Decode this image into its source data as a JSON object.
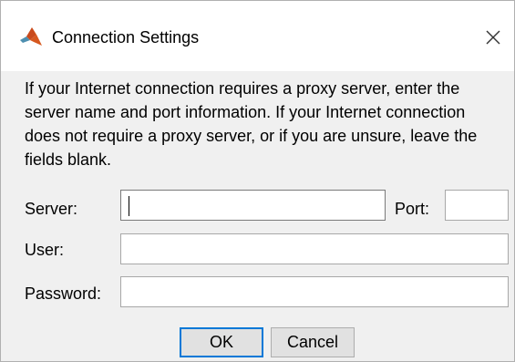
{
  "window": {
    "title": "Connection Settings",
    "app_icon": "matlab-membrane-icon",
    "close_icon": "close-icon"
  },
  "description": "If your Internet connection requires a proxy server, enter the server name and port information. If your Internet connection does not require a proxy server, or if you are unsure, leave the fields blank.",
  "form": {
    "server_label": "Server:",
    "server_value": "",
    "port_label": "Port:",
    "port_value": "",
    "user_label": "User:",
    "user_value": "",
    "password_label": "Password:",
    "password_value": ""
  },
  "buttons": {
    "ok_label": "OK",
    "cancel_label": "Cancel"
  },
  "colors": {
    "dialog_background": "#f0f0f0",
    "titlebar_background": "#ffffff",
    "default_button_border": "#0078d7"
  }
}
